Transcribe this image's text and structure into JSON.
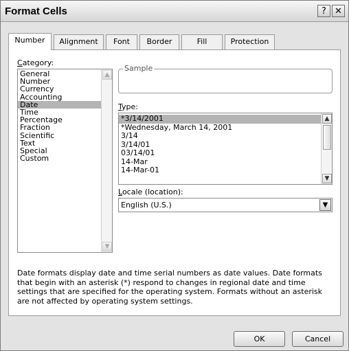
{
  "window": {
    "title": "Format Cells",
    "help_label": "?",
    "close_label": "✕"
  },
  "tabs": [
    {
      "label": "Number",
      "active": true
    },
    {
      "label": "Alignment",
      "active": false
    },
    {
      "label": "Font",
      "active": false
    },
    {
      "label": "Border",
      "active": false
    },
    {
      "label": "Fill",
      "active": false
    },
    {
      "label": "Protection",
      "active": false
    }
  ],
  "category": {
    "label_prefix": "C",
    "label_rest": "ategory:",
    "items": [
      "General",
      "Number",
      "Currency",
      "Accounting",
      "Date",
      "Time",
      "Percentage",
      "Fraction",
      "Scientific",
      "Text",
      "Special",
      "Custom"
    ],
    "selected": "Date"
  },
  "sample": {
    "label": "Sample",
    "value": ""
  },
  "type": {
    "label_prefix": "T",
    "label_rest": "ype:",
    "items": [
      "*3/14/2001",
      "*Wednesday, March 14, 2001",
      "3/14",
      "3/14/01",
      "03/14/01",
      "14-Mar",
      "14-Mar-01"
    ],
    "selected": "*3/14/2001"
  },
  "locale": {
    "label_prefix": "L",
    "label_rest": "ocale (location):",
    "value": "English (U.S.)"
  },
  "description": "Date formats display date and time serial numbers as date values.  Date formats that begin with an asterisk (*) respond to changes in regional date and time settings that are specified for the operating system. Formats without an asterisk are not affected by operating system settings.",
  "buttons": {
    "ok": "OK",
    "cancel": "Cancel"
  },
  "icons": {
    "scroll_up": "▲",
    "scroll_down": "▼",
    "dropdown": "▼"
  }
}
